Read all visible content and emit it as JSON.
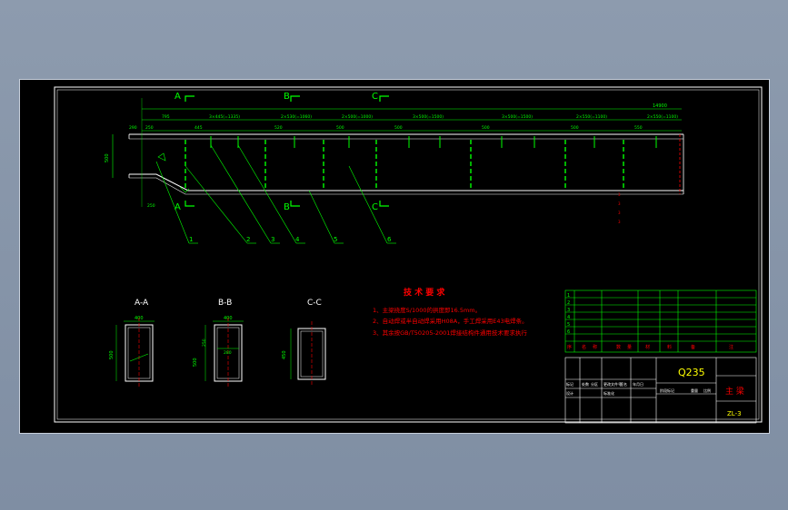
{
  "section_marks": {
    "a_top": "A",
    "b_top": "B",
    "c_top": "C",
    "a_bottom": "A",
    "b_bottom": "B",
    "c_bottom": "C"
  },
  "dimensions_top": {
    "total": "14900",
    "segments": [
      "795",
      "3×445(=1335)",
      "2×530(=1060)",
      "2×500(=1000)",
      "3×500(=1500)",
      "3×500(=1500)",
      "2×550(=1100)",
      "2×550(=1100)"
    ],
    "sub": [
      "290",
      "250",
      "445",
      "520",
      "500",
      "500",
      "500",
      "500",
      "550"
    ]
  },
  "dimensions_side": {
    "left_height": "500",
    "left_bottom": "250"
  },
  "leaders": [
    "1",
    "2",
    "3",
    "4",
    "5",
    "6"
  ],
  "sections": {
    "aa": {
      "title": "A-A",
      "width": "400",
      "height": "500"
    },
    "bb": {
      "title": "B-B",
      "width": "400",
      "height": "500",
      "inner_w": "280",
      "inner_h": "250"
    },
    "cc": {
      "title": "C-C",
      "height": "450"
    }
  },
  "tech_notes": {
    "title": "技 术 要 求",
    "items": [
      "1、主梁挠度S/1000的拱度即16.5mm。",
      "2、自动焊或半自动焊采用H08A，手工焊采用E43电焊条。",
      "3、其余按GB/T50205-2001焊接结构件通用技术要求执行"
    ]
  },
  "title_block": {
    "bom_rows": [
      "1",
      "2",
      "3",
      "4",
      "5",
      "6"
    ],
    "bom_header": [
      "序",
      "名",
      "称",
      "数",
      "量",
      "材",
      "料",
      "备",
      "注"
    ],
    "material": "Q235",
    "part_name": "主 梁",
    "drawing_no": "ZL-3",
    "sign_labels": [
      "标记",
      "处数",
      "分区",
      "更改文件号",
      "签名",
      "年月日"
    ],
    "design_labels": [
      "设计",
      "标准化",
      "阶段标记",
      "重量",
      "比例"
    ]
  },
  "colors": {
    "green": "#00ff00",
    "yellow": "#ffff00",
    "red": "#ff0000",
    "white": "#ffffff",
    "cyan": "#00ffff",
    "background": "#000000"
  }
}
